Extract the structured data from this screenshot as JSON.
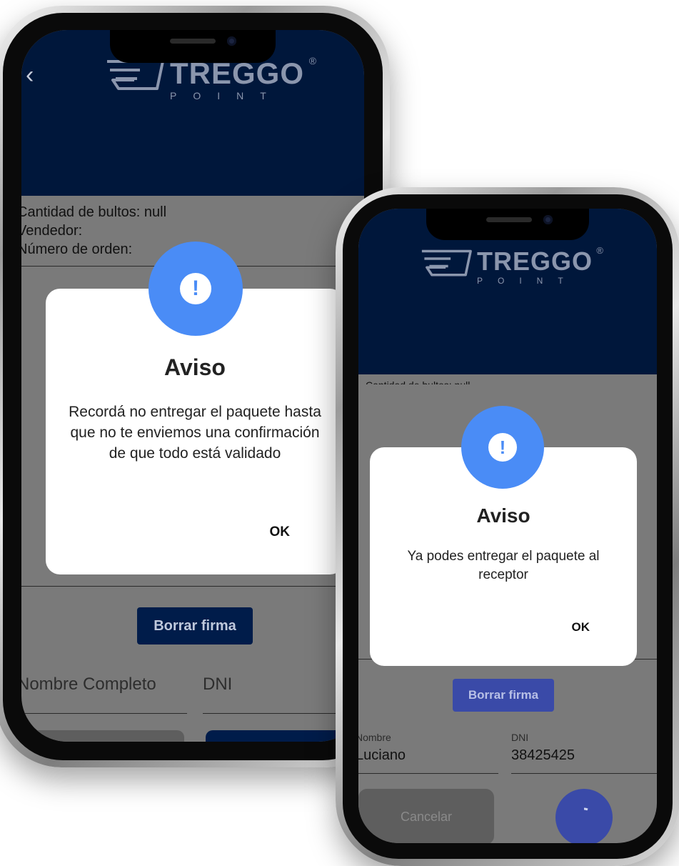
{
  "colors": {
    "header": "#00173b",
    "overlay": "#7a7a7a",
    "accent": "#4a8cf6",
    "button_dark": "#001c4a",
    "button_indigo": "#3a4aa8"
  },
  "brand": {
    "name": "TREGGO",
    "sub": "POINT",
    "reg": "®"
  },
  "left_phone": {
    "back_icon": "‹",
    "info": {
      "bultos": "Cantidad de bultos: null",
      "vendedor": "Vendedor:",
      "orden": "Número de orden:"
    },
    "dialog": {
      "icon": "!",
      "title": "Aviso",
      "message": "Recordá no entregar el paquete hasta que no te enviemos una confirmación de que todo está validado",
      "ok": "OK"
    },
    "borrar_firma": "Borrar firma",
    "nombre_placeholder": "Nombre Completo",
    "dni_placeholder": "DNI"
  },
  "right_phone": {
    "info_partial": "Cantidad de bultos: null",
    "dialog": {
      "icon": "!",
      "title": "Aviso",
      "message": "Ya podes entregar el paquete al receptor",
      "ok": "OK"
    },
    "borrar_firma": "Borrar firma",
    "nombre_label": "Nombre",
    "nombre_value": "Luciano",
    "dni_label": "DNI",
    "dni_value": "38425425",
    "cancelar": "Cancelar"
  }
}
